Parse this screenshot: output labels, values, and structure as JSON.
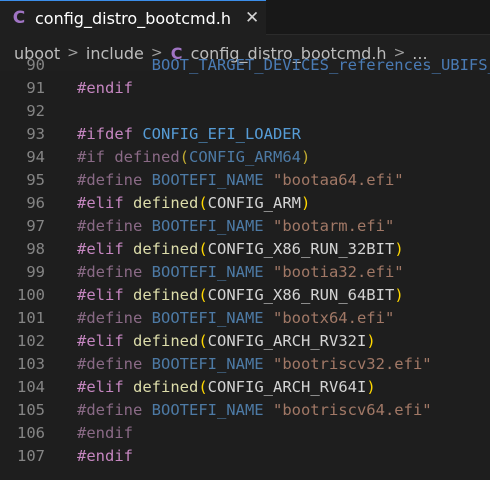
{
  "tab": {
    "icon": "c-language-icon",
    "icon_glyph": "C",
    "label": "config_distro_bootcmd.h",
    "close_glyph": "✕"
  },
  "breadcrumb": {
    "items": [
      "uboot",
      "include",
      "config_distro_bootcmd.h",
      "..."
    ],
    "separator": ">",
    "file_icon_glyph": "C"
  },
  "editor": {
    "lines": [
      {
        "num": "90",
        "tokens": [
          {
            "t": "        BOOT_TARGET_DEVICES_references_UBIFS_without_",
            "c": "t-faded"
          }
        ]
      },
      {
        "num": "91",
        "tokens": [
          {
            "t": "#endif",
            "c": "t-dir"
          }
        ]
      },
      {
        "num": "92",
        "tokens": []
      },
      {
        "num": "93",
        "tokens": [
          {
            "t": "#ifdef ",
            "c": "t-dir"
          },
          {
            "t": "CONFIG_EFI_LOADER",
            "c": "t-macro"
          }
        ]
      },
      {
        "num": "94",
        "tokens": [
          {
            "t": "#if ",
            "c": "t-inactive-dir"
          },
          {
            "t": "defined",
            "c": "t-inactive-dir"
          },
          {
            "t": "(",
            "c": "t-inactive-paren1"
          },
          {
            "t": "CONFIG_ARM64",
            "c": "t-inactive-macro"
          },
          {
            "t": ")",
            "c": "t-inactive-paren1"
          }
        ]
      },
      {
        "num": "95",
        "tokens": [
          {
            "t": "#define ",
            "c": "t-inactive-dir"
          },
          {
            "t": "BOOTEFI_NAME ",
            "c": "t-inactive-macro"
          },
          {
            "t": "\"bootaa64.efi\"",
            "c": "t-inactive-str"
          }
        ]
      },
      {
        "num": "96",
        "tokens": [
          {
            "t": "#elif ",
            "c": "t-dir"
          },
          {
            "t": "defined",
            "c": "t-func"
          },
          {
            "t": "(",
            "c": "t-paren1"
          },
          {
            "t": "CONFIG_ARM",
            "c": "t-plain"
          },
          {
            "t": ")",
            "c": "t-paren1"
          }
        ]
      },
      {
        "num": "97",
        "tokens": [
          {
            "t": "#define ",
            "c": "t-inactive-dir"
          },
          {
            "t": "BOOTEFI_NAME ",
            "c": "t-inactive-macro"
          },
          {
            "t": "\"bootarm.efi\"",
            "c": "t-inactive-str"
          }
        ]
      },
      {
        "num": "98",
        "tokens": [
          {
            "t": "#elif ",
            "c": "t-dir"
          },
          {
            "t": "defined",
            "c": "t-func"
          },
          {
            "t": "(",
            "c": "t-paren1"
          },
          {
            "t": "CONFIG_X86_RUN_32BIT",
            "c": "t-plain"
          },
          {
            "t": ")",
            "c": "t-paren1"
          }
        ]
      },
      {
        "num": "99",
        "tokens": [
          {
            "t": "#define ",
            "c": "t-inactive-dir"
          },
          {
            "t": "BOOTEFI_NAME ",
            "c": "t-inactive-macro"
          },
          {
            "t": "\"bootia32.efi\"",
            "c": "t-inactive-str"
          }
        ]
      },
      {
        "num": "100",
        "tokens": [
          {
            "t": "#elif ",
            "c": "t-dir"
          },
          {
            "t": "defined",
            "c": "t-func"
          },
          {
            "t": "(",
            "c": "t-paren1"
          },
          {
            "t": "CONFIG_X86_RUN_64BIT",
            "c": "t-plain"
          },
          {
            "t": ")",
            "c": "t-paren1"
          }
        ]
      },
      {
        "num": "101",
        "tokens": [
          {
            "t": "#define ",
            "c": "t-inactive-dir"
          },
          {
            "t": "BOOTEFI_NAME ",
            "c": "t-inactive-macro"
          },
          {
            "t": "\"bootx64.efi\"",
            "c": "t-inactive-str"
          }
        ]
      },
      {
        "num": "102",
        "tokens": [
          {
            "t": "#elif ",
            "c": "t-dir"
          },
          {
            "t": "defined",
            "c": "t-func"
          },
          {
            "t": "(",
            "c": "t-paren1"
          },
          {
            "t": "CONFIG_ARCH_RV32I",
            "c": "t-plain"
          },
          {
            "t": ")",
            "c": "t-paren1"
          }
        ]
      },
      {
        "num": "103",
        "tokens": [
          {
            "t": "#define ",
            "c": "t-inactive-dir"
          },
          {
            "t": "BOOTEFI_NAME ",
            "c": "t-inactive-macro"
          },
          {
            "t": "\"bootriscv32.efi\"",
            "c": "t-inactive-str"
          }
        ]
      },
      {
        "num": "104",
        "tokens": [
          {
            "t": "#elif ",
            "c": "t-dir"
          },
          {
            "t": "defined",
            "c": "t-func"
          },
          {
            "t": "(",
            "c": "t-paren1"
          },
          {
            "t": "CONFIG_ARCH_RV64I",
            "c": "t-plain"
          },
          {
            "t": ")",
            "c": "t-paren1"
          }
        ]
      },
      {
        "num": "105",
        "tokens": [
          {
            "t": "#define ",
            "c": "t-inactive-dir"
          },
          {
            "t": "BOOTEFI_NAME ",
            "c": "t-inactive-macro"
          },
          {
            "t": "\"bootriscv64.efi\"",
            "c": "t-inactive-str"
          }
        ]
      },
      {
        "num": "106",
        "tokens": [
          {
            "t": "#endif",
            "c": "t-inactive-dir"
          }
        ]
      },
      {
        "num": "107",
        "tokens": [
          {
            "t": "#endif",
            "c": "t-dir"
          }
        ]
      }
    ]
  },
  "colors": {
    "background": "#1e1e1e",
    "tab_accent": "#3b8eea",
    "c_icon": "#a074c4",
    "directive": "#c586c0",
    "macro": "#569cd6",
    "function": "#dcdcaa",
    "string": "#ce9178",
    "bracket": "#ffd700",
    "line_number": "#858585"
  }
}
